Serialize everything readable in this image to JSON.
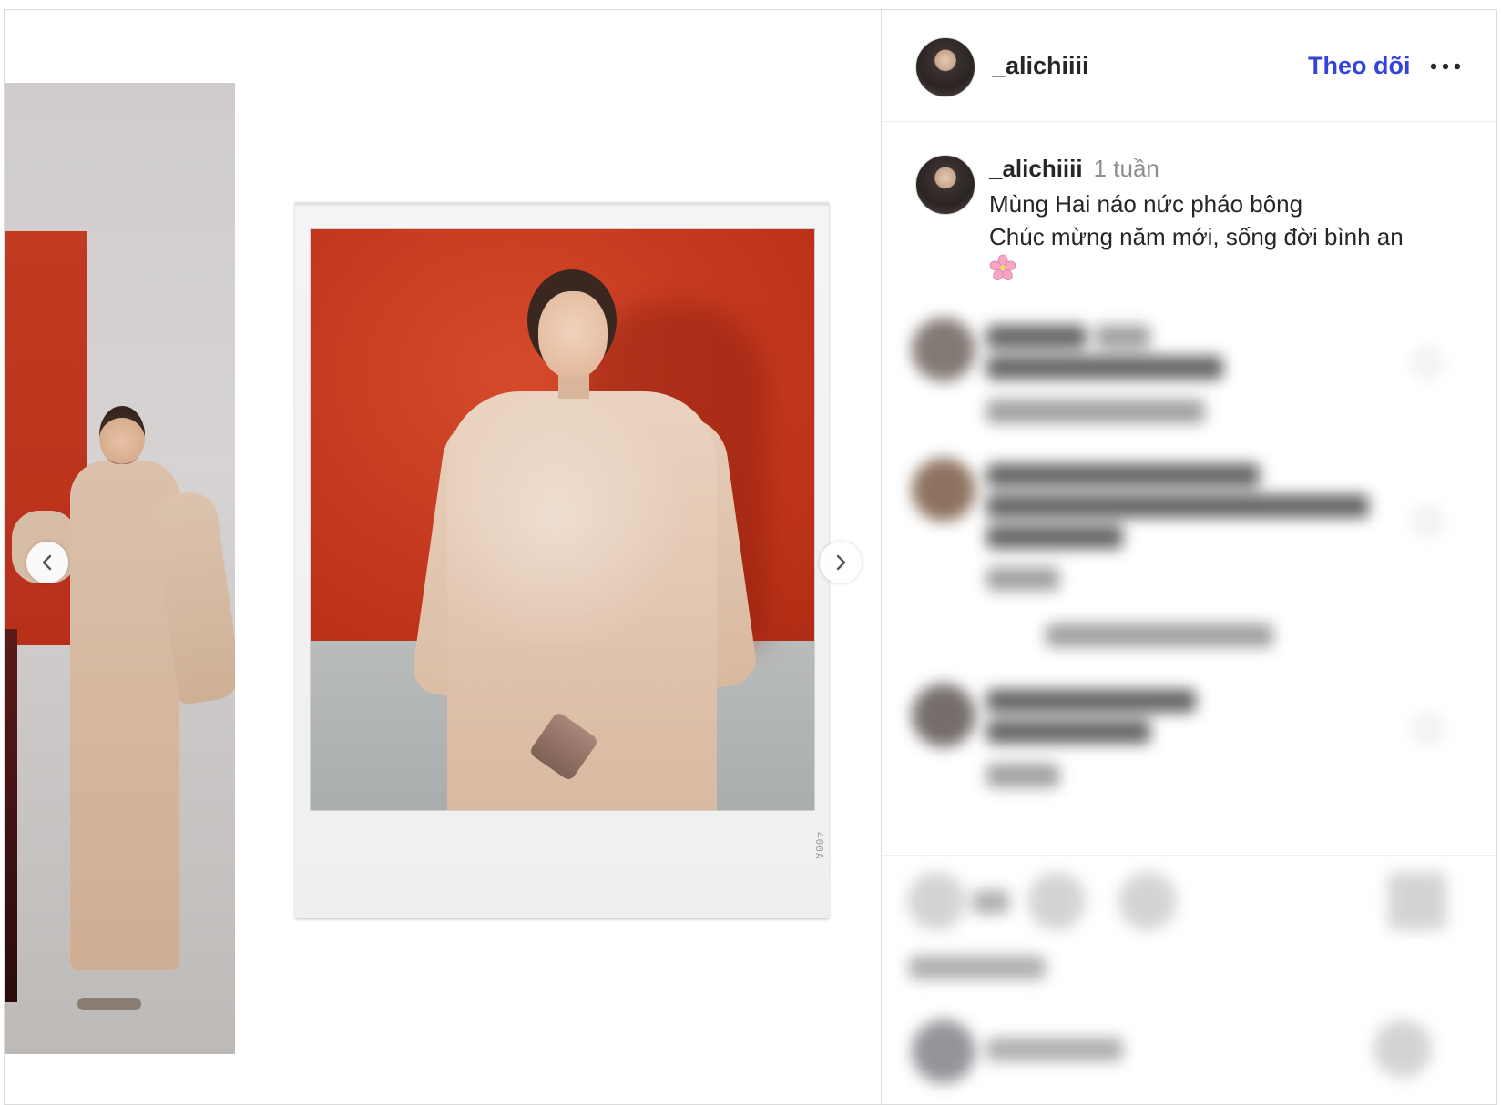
{
  "post": {
    "author": "_alichiiii",
    "follow_label": "Theo dõi",
    "more_label": "More options",
    "caption_username": "_alichiiii",
    "caption_time": "1 tuần",
    "caption_line1": "Mùng Hai náo nức pháo bông",
    "caption_line2": "Chúc mừng năm mới, sống đời bình an",
    "caption_emoji_icon": "cherry-blossom-icon",
    "photo_stamp": "400A"
  },
  "colors": {
    "follow": "#3444d8",
    "text": "#262626",
    "muted": "#8e8e8e",
    "border": "#dbdbdb"
  },
  "icons": {
    "carousel_prev": "chevron-left-icon",
    "carousel_next": "chevron-right-icon",
    "more": "ellipsis-icon"
  }
}
